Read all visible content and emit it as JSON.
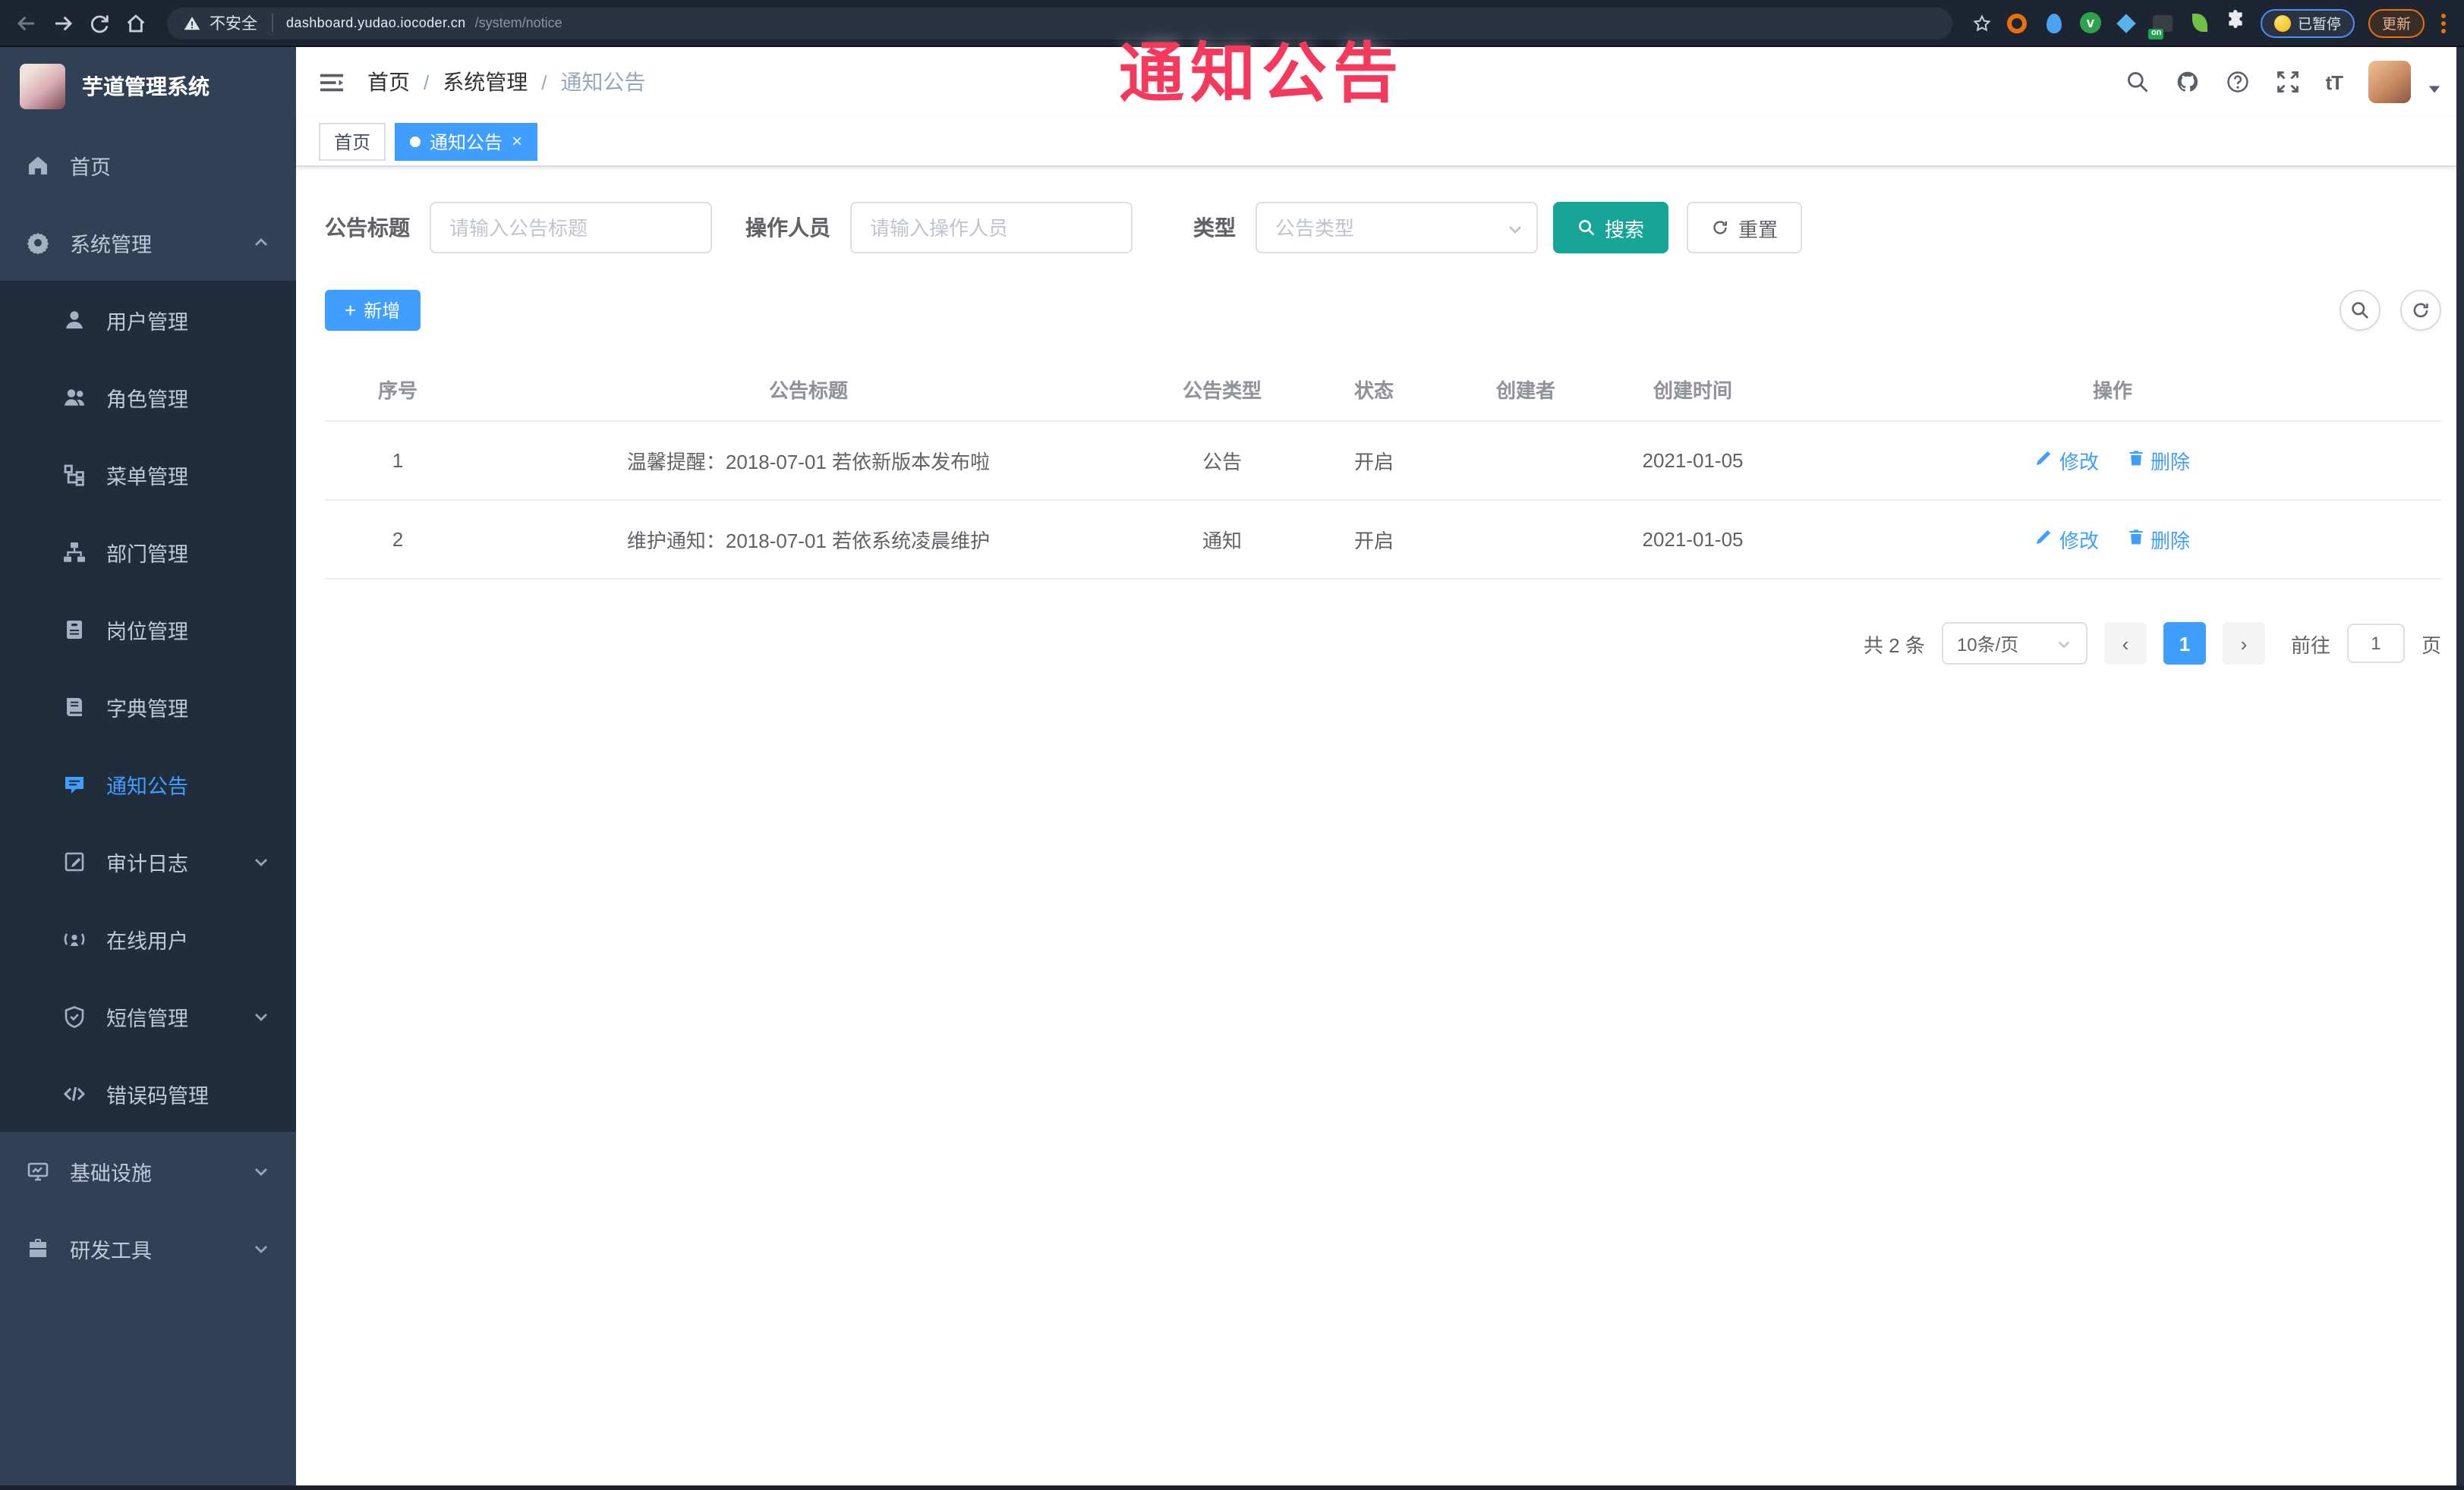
{
  "browser": {
    "security_label": "不安全",
    "url_host": "dashboard.yudao.iocoder.cn",
    "url_path": "/system/notice",
    "paused_label": "已暂停",
    "update_label": "更新",
    "nav_icons": [
      "back-icon",
      "forward-icon",
      "reload-icon",
      "home-icon"
    ],
    "extensions": [
      {
        "icon": "bookmark-star-icon",
        "type": "star",
        "color": "#c9cfd9"
      },
      {
        "icon": "ext-orange-ring-icon",
        "type": "ring",
        "color": "#e8710a"
      },
      {
        "icon": "ext-blue-drop-icon",
        "type": "drop",
        "color": "#4aa3ef"
      },
      {
        "icon": "ext-green-circle-icon",
        "type": "circle-v",
        "color": "#2fa24c",
        "letter": "v"
      },
      {
        "icon": "ext-blue-diamond-icon",
        "type": "diamond",
        "color": "#58b1e8"
      },
      {
        "icon": "ext-dark-box-icon",
        "type": "dark-badge",
        "color": "#3a3d42",
        "badge": "on",
        "badge_color": "#21a453"
      },
      {
        "icon": "ext-green-leaf-icon",
        "type": "leaf",
        "color": "#71bf44"
      },
      {
        "icon": "extensions-puzzle-icon",
        "type": "puzzle",
        "color": "#e8eaed"
      }
    ]
  },
  "annotation": {
    "text": "通知公告",
    "color": "#f5395c"
  },
  "sidebar": {
    "logo_title": "芋道管理系统",
    "items": [
      {
        "label": "首页",
        "icon": "home-menu-icon",
        "level": "top"
      },
      {
        "label": "系统管理",
        "icon": "gear-icon",
        "level": "top",
        "chevron": "up"
      },
      {
        "label": "用户管理",
        "icon": "user-icon",
        "level": "sub"
      },
      {
        "label": "角色管理",
        "icon": "users-icon",
        "level": "sub"
      },
      {
        "label": "菜单管理",
        "icon": "menu-tree-icon",
        "level": "sub"
      },
      {
        "label": "部门管理",
        "icon": "org-tree-icon",
        "level": "sub"
      },
      {
        "label": "岗位管理",
        "icon": "id-badge-icon",
        "level": "sub"
      },
      {
        "label": "字典管理",
        "icon": "dictionary-icon",
        "level": "sub"
      },
      {
        "label": "通知公告",
        "icon": "message-icon",
        "level": "sub",
        "active": true
      },
      {
        "label": "审计日志",
        "icon": "audit-log-icon",
        "level": "sub",
        "chevron": "down"
      },
      {
        "label": "在线用户",
        "icon": "online-user-icon",
        "level": "sub"
      },
      {
        "label": "短信管理",
        "icon": "shield-sms-icon",
        "level": "sub",
        "chevron": "down"
      },
      {
        "label": "错误码管理",
        "icon": "code-icon",
        "level": "sub"
      },
      {
        "label": "基础设施",
        "icon": "monitor-icon",
        "level": "top",
        "chevron": "down"
      },
      {
        "label": "研发工具",
        "icon": "toolbox-icon",
        "level": "top",
        "chevron": "down"
      }
    ]
  },
  "topbar": {
    "breadcrumb": [
      "首页",
      "系统管理",
      "通知公告"
    ],
    "separator": "/",
    "right_icons": [
      "search-icon",
      "github-icon",
      "help-icon",
      "fullscreen-icon",
      "font-size-icon",
      "avatar",
      "chevron-down-icon"
    ],
    "font_size_glyph": "tT"
  },
  "tabs": {
    "close_glyph": "×",
    "items": [
      {
        "label": "首页",
        "active": false,
        "closable": false
      },
      {
        "label": "通知公告",
        "active": true,
        "closable": true
      }
    ]
  },
  "filters": {
    "title_label": "公告标题",
    "title_placeholder": "请输入公告标题",
    "operator_label": "操作人员",
    "operator_placeholder": "请输入操作人员",
    "type_label": "类型",
    "type_placeholder": "公告类型",
    "search_label": "搜索",
    "reset_label": "重置"
  },
  "toolbar": {
    "add_label": "新增",
    "plus_glyph": "+",
    "corner_icons": [
      "search-toggle-icon",
      "refresh-icon"
    ]
  },
  "table": {
    "headers": [
      "序号",
      "公告标题",
      "公告类型",
      "状态",
      "创建者",
      "创建时间",
      "操作"
    ],
    "rows": [
      {
        "no": "1",
        "title": "温馨提醒：2018-07-01 若依新版本发布啦",
        "type": "公告",
        "status": "开启",
        "creator": "",
        "created": "2021-01-05"
      },
      {
        "no": "2",
        "title": "维护通知：2018-07-01 若依系统凌晨维护",
        "type": "通知",
        "status": "开启",
        "creator": "",
        "created": "2021-01-05"
      }
    ],
    "edit_label": "修改",
    "delete_label": "删除"
  },
  "pagination": {
    "total_text": "共 2 条",
    "page_size": "10条/页",
    "prev_glyph": "‹",
    "current_page": "1",
    "next_glyph": "›",
    "goto_label": "前往",
    "goto_value": "1",
    "page_suffix": "页"
  },
  "colors": {
    "accent": "#409eff",
    "search_button": "#17a598",
    "sidebar_bg": "#304156",
    "submenu_bg": "#1f2d3d",
    "annotation": "#f5395c",
    "chrome_bg": "#1d2533"
  }
}
